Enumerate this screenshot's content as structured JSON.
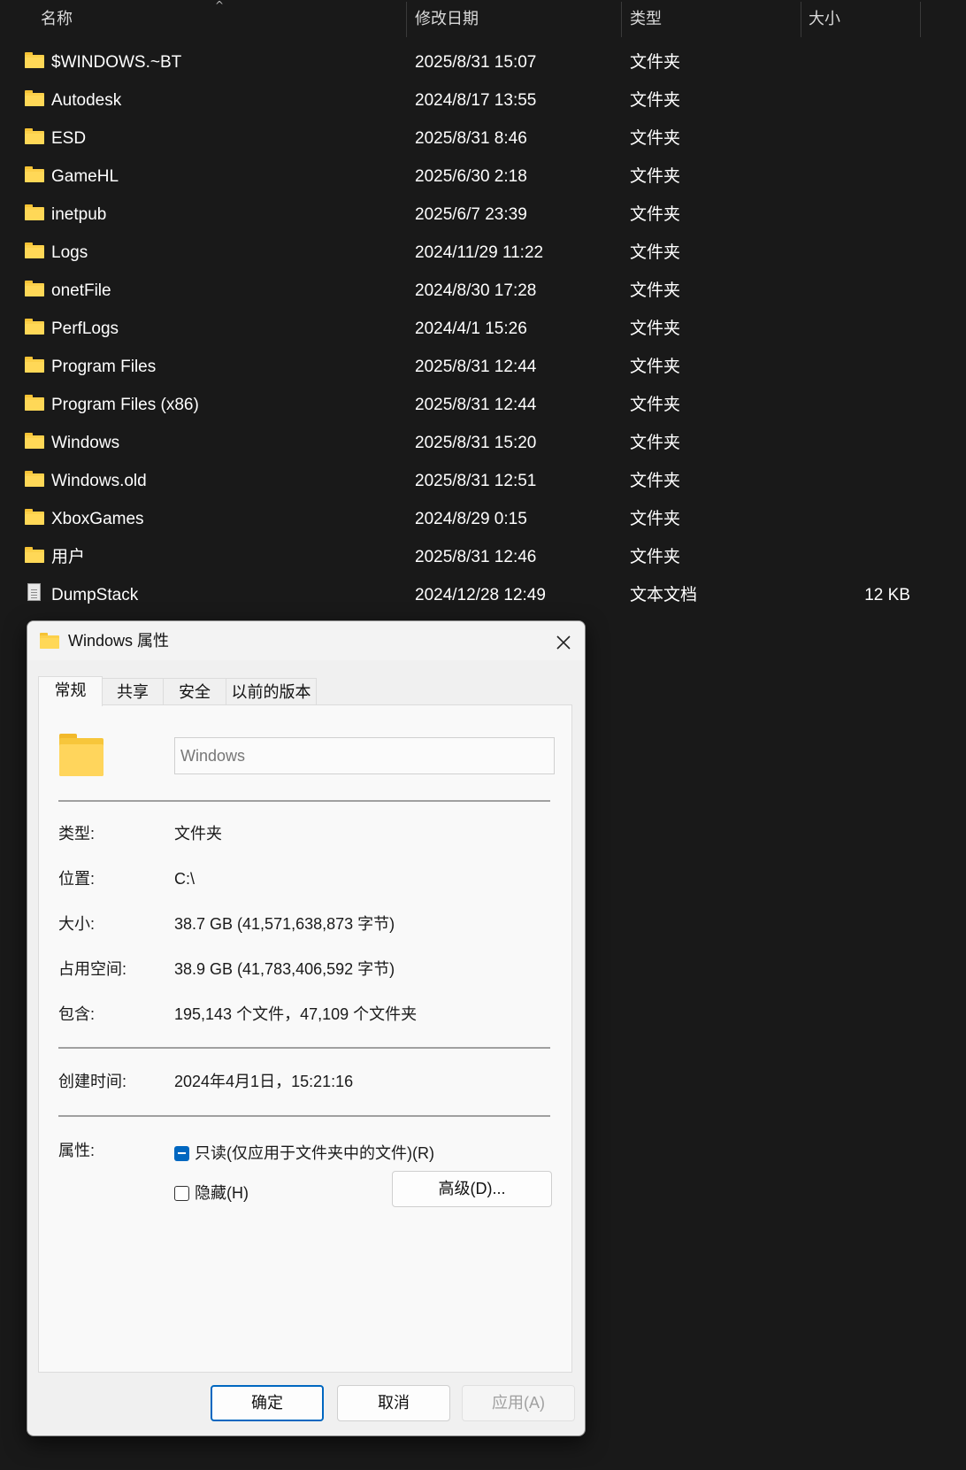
{
  "explorer": {
    "columns": {
      "name": "名称",
      "date": "修改日期",
      "type": "类型",
      "size": "大小"
    },
    "rows": [
      {
        "name": "$WINDOWS.~BT",
        "date": "2025/8/31 15:07",
        "type": "文件夹",
        "size": "",
        "icon": "folder-icon"
      },
      {
        "name": "Autodesk",
        "date": "2024/8/17 13:55",
        "type": "文件夹",
        "size": "",
        "icon": "folder-icon"
      },
      {
        "name": "ESD",
        "date": "2025/8/31 8:46",
        "type": "文件夹",
        "size": "",
        "icon": "folder-icon"
      },
      {
        "name": "GameHL",
        "date": "2025/6/30 2:18",
        "type": "文件夹",
        "size": "",
        "icon": "folder-icon"
      },
      {
        "name": "inetpub",
        "date": "2025/6/7 23:39",
        "type": "文件夹",
        "size": "",
        "icon": "folder-icon"
      },
      {
        "name": "Logs",
        "date": "2024/11/29 11:22",
        "type": "文件夹",
        "size": "",
        "icon": "folder-icon"
      },
      {
        "name": "onetFile",
        "date": "2024/8/30 17:28",
        "type": "文件夹",
        "size": "",
        "icon": "folder-icon"
      },
      {
        "name": "PerfLogs",
        "date": "2024/4/1 15:26",
        "type": "文件夹",
        "size": "",
        "icon": "folder-icon"
      },
      {
        "name": "Program Files",
        "date": "2025/8/31 12:44",
        "type": "文件夹",
        "size": "",
        "icon": "folder-icon"
      },
      {
        "name": "Program Files (x86)",
        "date": "2025/8/31 12:44",
        "type": "文件夹",
        "size": "",
        "icon": "folder-icon"
      },
      {
        "name": "Windows",
        "date": "2025/8/31 15:20",
        "type": "文件夹",
        "size": "",
        "icon": "folder-icon"
      },
      {
        "name": "Windows.old",
        "date": "2025/8/31 12:51",
        "type": "文件夹",
        "size": "",
        "icon": "folder-icon"
      },
      {
        "name": "XboxGames",
        "date": "2024/8/29 0:15",
        "type": "文件夹",
        "size": "",
        "icon": "folder-icon"
      },
      {
        "name": "用户",
        "date": "2025/8/31 12:46",
        "type": "文件夹",
        "size": "",
        "icon": "folder-icon"
      },
      {
        "name": "DumpStack",
        "date": "2024/12/28 12:49",
        "type": "文本文档",
        "size": "12 KB",
        "icon": "text-file-icon"
      }
    ]
  },
  "dialog": {
    "title": "Windows 属性",
    "close_icon": "close-icon",
    "tabs": [
      {
        "label": "常规",
        "active": true
      },
      {
        "label": "共享",
        "active": false
      },
      {
        "label": "安全",
        "active": false
      },
      {
        "label": "以前的版本",
        "active": false
      }
    ],
    "name_field_value": "Windows",
    "type_label": "类型:",
    "type_value": "文件夹",
    "location_label": "位置:",
    "location_value": "C:\\",
    "size_label": "大小:",
    "size_value": "38.7 GB (41,571,638,873 字节)",
    "size_on_disk_label": "占用空间:",
    "size_on_disk_value": "38.9 GB (41,783,406,592 字节)",
    "contains_label": "包含:",
    "contains_value": "195,143 个文件，47,109 个文件夹",
    "created_label": "创建时间:",
    "created_value": "2024年4月1日，15:21:16",
    "attributes_label": "属性:",
    "readonly_label": "只读(仅应用于文件夹中的文件)(R)",
    "readonly_state": "indeterminate",
    "hidden_label": "隐藏(H)",
    "hidden_checked": false,
    "advanced_button": "高级(D)...",
    "ok_button": "确定",
    "cancel_button": "取消",
    "apply_button": "应用(A)",
    "accent_color": "#0067c0"
  }
}
